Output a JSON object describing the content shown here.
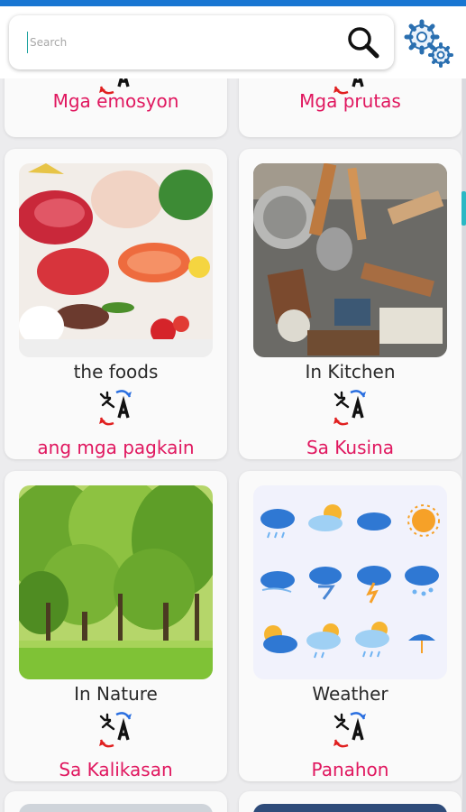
{
  "search": {
    "placeholder": "Search"
  },
  "icons": {
    "search": "search-icon",
    "settings": "gear-icon",
    "translate": "translate-icon"
  },
  "colors": {
    "accent_pink": "#e0175f",
    "status_blue": "#1976d2",
    "scroll_teal": "#2bb8c4"
  },
  "categories": [
    {
      "label": "",
      "translation": "Mga emosyon"
    },
    {
      "label": "",
      "translation": "Mga prutas"
    },
    {
      "label": "the foods",
      "translation": "ang mga pagkain"
    },
    {
      "label": "In Kitchen",
      "translation": "Sa Kusina"
    },
    {
      "label": "In Nature",
      "translation": "Sa Kalikasan"
    },
    {
      "label": "Weather",
      "translation": "Panahon"
    }
  ]
}
